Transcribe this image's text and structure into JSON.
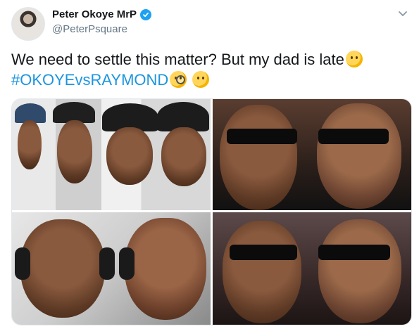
{
  "user": {
    "display_name": "Peter Okoye MrP",
    "handle": "@PeterPsquare",
    "verified": true
  },
  "tweet": {
    "text_line1": "We need to settle this matter? But my dad is late",
    "hashtag": "#OKOYEvsRAYMOND"
  },
  "icons": {
    "verified": "verified-badge-icon",
    "caret": "chevron-down-icon",
    "emoji_thinking": "thinking-face-emoji",
    "emoji_monocle": "face-with-monocle-emoji"
  },
  "colors": {
    "accent": "#1b95e0",
    "verified": "#1da1f2",
    "muted": "#657786",
    "text": "#14171a"
  }
}
